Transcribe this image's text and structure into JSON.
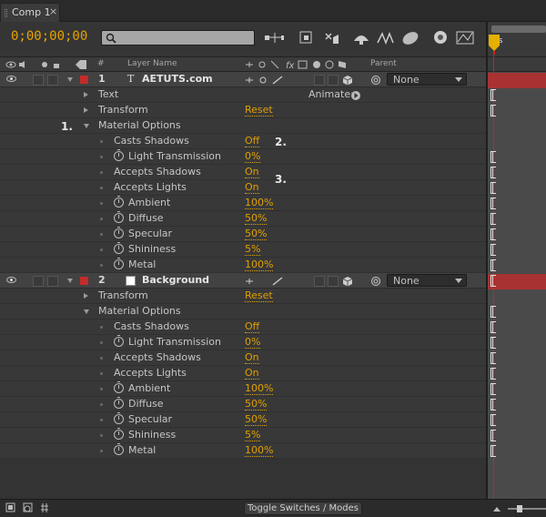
{
  "tab": {
    "name": "Comp 1",
    "close": "×"
  },
  "toolbar": {
    "timecode": "0;00;00;00",
    "search_placeholder": ""
  },
  "timeline": {
    "time_label": "0s"
  },
  "header": {
    "hash": "#",
    "layer_name": "Layer Name",
    "parent": "Parent"
  },
  "layers": [
    {
      "number": "1",
      "name": "AETUTS.com",
      "parent": "None",
      "text_label": "Text",
      "animate_label": "Animate:",
      "transform_label": "Transform",
      "transform_value": "Reset",
      "material_label": "Material Options",
      "props": [
        {
          "label": "Casts Shadows",
          "value": "Off",
          "stopwatch": false
        },
        {
          "label": "Light Transmission",
          "value": "0%",
          "stopwatch": true
        },
        {
          "label": "Accepts Shadows",
          "value": "On",
          "stopwatch": false
        },
        {
          "label": "Accepts Lights",
          "value": "On",
          "stopwatch": false
        },
        {
          "label": "Ambient",
          "value": "100%",
          "stopwatch": true
        },
        {
          "label": "Diffuse",
          "value": "50%",
          "stopwatch": true
        },
        {
          "label": "Specular",
          "value": "50%",
          "stopwatch": true
        },
        {
          "label": "Shininess",
          "value": "5%",
          "stopwatch": true
        },
        {
          "label": "Metal",
          "value": "100%",
          "stopwatch": true
        }
      ]
    },
    {
      "number": "2",
      "name": "Background",
      "parent": "None",
      "transform_label": "Transform",
      "transform_value": "Reset",
      "material_label": "Material Options",
      "props": [
        {
          "label": "Casts Shadows",
          "value": "Off",
          "stopwatch": false
        },
        {
          "label": "Light Transmission",
          "value": "0%",
          "stopwatch": true
        },
        {
          "label": "Accepts Shadows",
          "value": "On",
          "stopwatch": false
        },
        {
          "label": "Accepts Lights",
          "value": "On",
          "stopwatch": false
        },
        {
          "label": "Ambient",
          "value": "100%",
          "stopwatch": true
        },
        {
          "label": "Diffuse",
          "value": "50%",
          "stopwatch": true
        },
        {
          "label": "Specular",
          "value": "50%",
          "stopwatch": true
        },
        {
          "label": "Shininess",
          "value": "5%",
          "stopwatch": true
        },
        {
          "label": "Metal",
          "value": "100%",
          "stopwatch": true
        }
      ]
    }
  ],
  "annotations": {
    "a1": "1.",
    "a2": "2.",
    "a3": "3."
  },
  "footer": {
    "toggle_label": "Toggle Switches / Modes"
  },
  "colors": {
    "accent": "#e0a000",
    "label_red": "#c42b2b",
    "timeline_bar": "#a83232",
    "playhead": "#d02020"
  }
}
